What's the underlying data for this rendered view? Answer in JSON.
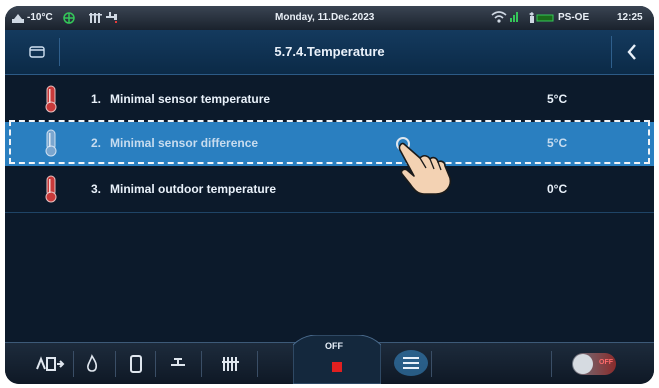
{
  "status_bar": {
    "outdoor_temp": "-10°C",
    "date": "Monday, 11.Dec.2023",
    "profile": "PS-OE",
    "time": "12:25"
  },
  "header": {
    "title": "5.7.4.Temperature"
  },
  "rows": [
    {
      "number": "1.",
      "label": "Minimal sensor temperature",
      "value": "5°C",
      "selected": false
    },
    {
      "number": "2.",
      "label": "Minimal sensor difference",
      "value": "5°C",
      "selected": true
    },
    {
      "number": "3.",
      "label": "Minimal outdoor temperature",
      "value": "0°C",
      "selected": false
    }
  ],
  "bottom_bar": {
    "mode_label": "OFF",
    "toggle_label": "OFF"
  },
  "colors": {
    "background": "#0c1a2b",
    "header": "#143a5e",
    "selected_row": "#2a7fc0",
    "thermometer_red": "#c93a3a",
    "thermometer_blue": "#7aa6cf",
    "stop_red": "#e02020"
  },
  "icons": [
    "outdoor-temp-icon",
    "fan-icon",
    "radiator-icon",
    "tap-icon",
    "wifi-icon",
    "battery-icon",
    "folder-icon",
    "back-arrow-icon",
    "thermometer-icon",
    "hand-pointer-icon",
    "heating-mode-icon",
    "flame-icon",
    "boiler-icon",
    "valve-icon",
    "heater-icon",
    "stop-icon",
    "menu-icon"
  ]
}
